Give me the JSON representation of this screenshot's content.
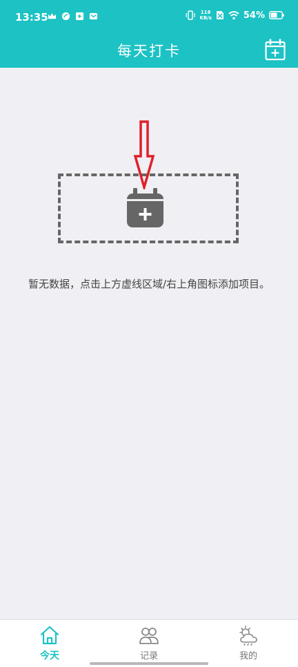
{
  "status_bar": {
    "time": "13:35",
    "network_speed_value": "118",
    "network_speed_unit": "KB/s",
    "battery": "54%",
    "icons": [
      "crown-icon",
      "leaf-icon",
      "play-icon",
      "mail-icon",
      "vibrate-icon",
      "sim-off-icon",
      "wifi-icon",
      "battery-icon"
    ]
  },
  "header": {
    "title": "每天打卡",
    "add_icon": "calendar-add-icon"
  },
  "empty_state": {
    "add_icon": "calendar-add-icon",
    "annotation": "red-down-arrow-icon",
    "message": "暂无数据，点击上方虚线区域/右上角图标添加项目。"
  },
  "tabs": [
    {
      "label": "今天",
      "icon": "home-icon",
      "active": true
    },
    {
      "label": "记录",
      "icon": "people-icon",
      "active": false
    },
    {
      "label": "我的",
      "icon": "weather-icon",
      "active": false
    }
  ],
  "colors": {
    "accent": "#1cc2c4",
    "background": "#efeff4",
    "dashed_border": "#666666",
    "arrow": "#e0202a"
  }
}
